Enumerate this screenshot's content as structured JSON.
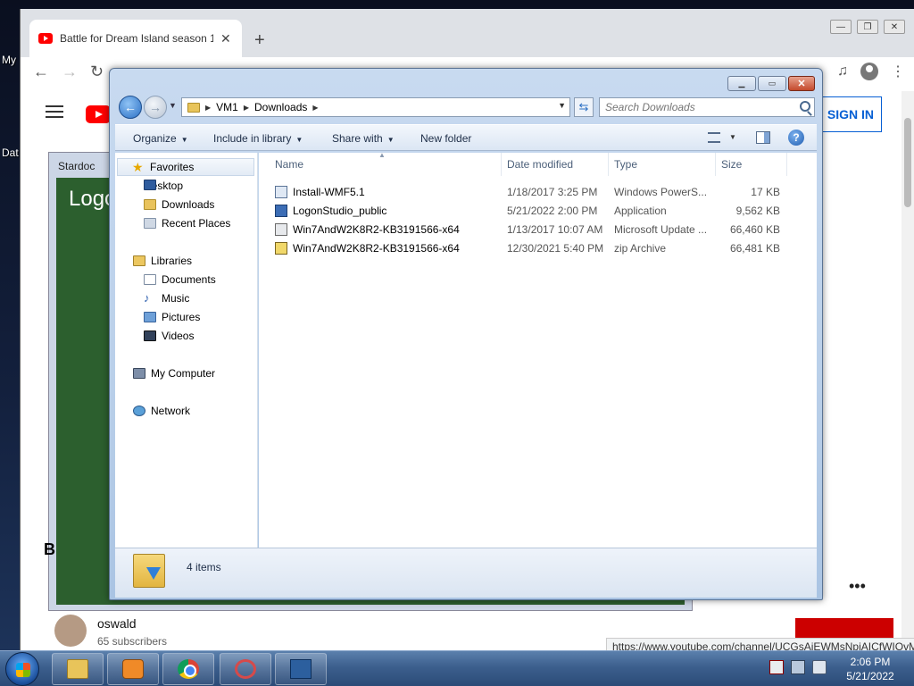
{
  "desktop": {
    "icon_labels": [
      "My",
      "Dat"
    ]
  },
  "browser": {
    "tab_title": "Battle for Dream Island season 1",
    "new_tab": "+",
    "sign_in": "SIGN IN",
    "stardock_title": "Stardoc",
    "logon_text": "Logo",
    "heading_fragment": "B",
    "more_dots": "•••",
    "channel": {
      "name": "oswald",
      "subscribers": "65 subscribers"
    },
    "status_url": "https://www.youtube.com/channel/UCGsAjEWMsNpjAICfWIOvMJA"
  },
  "explorer": {
    "breadcrumb": [
      "VM1",
      "Downloads"
    ],
    "search_placeholder": "Search Downloads",
    "commands": {
      "organize": "Organize",
      "include_in_library": "Include in library",
      "share_with": "Share with",
      "new_folder": "New folder"
    },
    "nav": {
      "favorites": "Favorites",
      "favorites_items": [
        "Desktop",
        "Downloads",
        "Recent Places"
      ],
      "libraries": "Libraries",
      "libraries_items": [
        "Documents",
        "Music",
        "Pictures",
        "Videos"
      ],
      "computer": "My Computer",
      "network": "Network"
    },
    "columns": [
      "Name",
      "Date modified",
      "Type",
      "Size"
    ],
    "files": [
      {
        "name": "Install-WMF5.1",
        "date": "1/18/2017 3:25 PM",
        "type": "Windows PowerS...",
        "size": "17 KB",
        "icon": "powershell-script-icon"
      },
      {
        "name": "LogonStudio_public",
        "date": "5/21/2022 2:00 PM",
        "type": "Application",
        "size": "9,562 KB",
        "icon": "application-icon"
      },
      {
        "name": "Win7AndW2K8R2-KB3191566-x64",
        "date": "1/13/2017 10:07 AM",
        "type": "Microsoft Update ...",
        "size": "66,460 KB",
        "icon": "update-package-icon"
      },
      {
        "name": "Win7AndW2K8R2-KB3191566-x64",
        "date": "12/30/2021 5:40 PM",
        "type": "zip Archive",
        "size": "66,481 KB",
        "icon": "zip-archive-icon"
      }
    ],
    "item_count": "4 items"
  },
  "taskbar": {
    "time": "2:06 PM",
    "date": "5/21/2022"
  }
}
